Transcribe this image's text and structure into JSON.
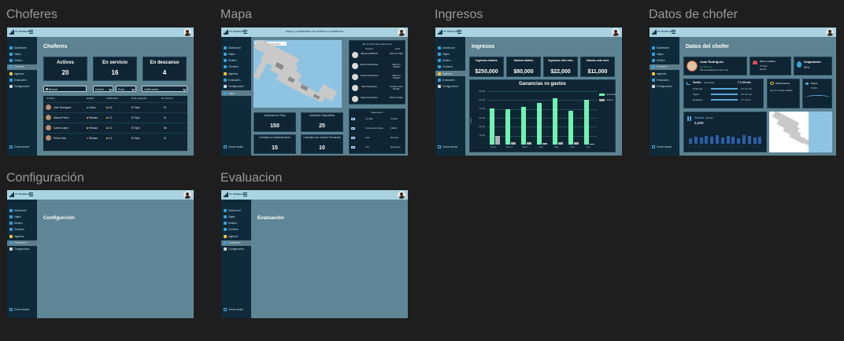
{
  "frames": {
    "choferes_title": "Choferes",
    "mapa_title": "Mapa",
    "ingresos_title": "Ingresos",
    "datos_title": "Datos de chofer",
    "config_title": "Configuración",
    "evaluacion_title": "Evaluacion"
  },
  "brand": "ZT TRABAJO",
  "sidebar": {
    "items": [
      "Dashboard",
      "Viajes",
      "Destino",
      "Choferes",
      "Ingresos",
      "Evaluación",
      "Configuración"
    ],
    "logout": "Cerrar sesión",
    "icon_colors": [
      "#3aa0d8",
      "#3aa0d8",
      "#3aa0d8",
      "#3aa0d8",
      "#f3c23a",
      "#3aa0d8",
      "#cfd8dc"
    ]
  },
  "choferes": {
    "title": "Choferes",
    "cards": [
      {
        "label": "Activos",
        "value": "20"
      },
      {
        "label": "En servicio",
        "value": "16"
      },
      {
        "label": "En descanso",
        "value": "4"
      }
    ],
    "search_placeholder": "Buscar",
    "filters": [
      "Estado",
      "Ruta",
      "Calificación"
    ],
    "columns": [
      "Nombre",
      "Estado",
      "Calificación",
      "Ruta asignada",
      "En servicio"
    ],
    "rows": [
      {
        "name": "Juan Rodríguez",
        "status": "Activo",
        "status_color": "#3ec87a",
        "rating": "4.6",
        "route": "El Tajín",
        "service": "Sí"
      },
      {
        "name": "Manuel Pérez",
        "status": "Retraso",
        "status_color": "#f3c23a",
        "rating": "4.2",
        "route": "El Tajín",
        "service": "Sí"
      },
      {
        "name": "Carlos López",
        "status": "Retraso",
        "status_color": "#f3c23a",
        "rating": "4.0",
        "route": "El Tajín",
        "service": "No"
      },
      {
        "name": "Pedro Díaz",
        "status": "Retraso",
        "status_color": "#e05050",
        "rating": "4.1",
        "route": "El Tajín",
        "service": "Sí"
      }
    ]
  },
  "mapa": {
    "header": "Mapa y Localización de choferes y estaciones",
    "search_placeholder": "Buscar estación de Metro",
    "driver_list_title": "Top en línea que quieres ver",
    "driver_cols": [
      "Nombre",
      "Ruta"
    ],
    "drivers": [
      {
        "name": "Miguel CORROS",
        "route": "Metro el Tajín"
      },
      {
        "name": "Ramiro Rodríguez",
        "route": "Metro el Pueblo"
      },
      {
        "name": "Jhosue Rodríguez",
        "route": "Metro el Pueblo"
      },
      {
        "name": "Juan Rodríguez",
        "route": "Centro Loma Bonita"
      },
      {
        "name": "Diego Hernández",
        "route": "Metro el Tajín"
      }
    ],
    "stats": [
      {
        "label": "Autobuses en Ruta",
        "value": "150"
      },
      {
        "label": "Autobuses Disponibles",
        "value": "25"
      },
      {
        "label": "Unidades en Mantenimiento",
        "value": "15"
      },
      {
        "label": "Unidades con Gestión Terminada",
        "value": "10"
      }
    ],
    "stations_title": "Estaciones",
    "stations": [
      {
        "name": "La Sala",
        "place": "Puebla"
      },
      {
        "name": "Terminal del Norte",
        "place": "CDMX"
      },
      {
        "name": "Gral.",
        "place": "Morelos"
      },
      {
        "name": "TGI",
        "place": "Querétaro"
      }
    ]
  },
  "ingresos": {
    "title": "Ingresos",
    "kpis": [
      {
        "label": "Ingresos totales",
        "value": "$250,000"
      },
      {
        "label": "Gastos totales",
        "value": "$80,000"
      },
      {
        "label": "Ingresos este mes",
        "value": "$22,000"
      },
      {
        "label": "Gastos este mes",
        "value": "$11,000"
      }
    ]
  },
  "chart_data": {
    "type": "bar",
    "title": "Ganancias vs gastos",
    "ylabel": "Pesos",
    "categories": [
      "Enero",
      "Febrero",
      "Marzo",
      "Abril",
      "Mayo",
      "Junio",
      "Julio"
    ],
    "ylim": [
      0,
      60000
    ],
    "yticks": [
      "60,000",
      "50,000",
      "40,000",
      "30,000",
      "20,000",
      "10,000"
    ],
    "series": [
      {
        "name": "Ganancias",
        "color": "#6ff3b0",
        "values": [
          41000,
          40000,
          42000,
          47000,
          52000,
          38000,
          50000
        ]
      },
      {
        "name": "Gastos",
        "color": "#b0b0b0",
        "values": [
          10000,
          3000,
          3000,
          2000,
          3000,
          3000,
          1000
        ]
      }
    ]
  },
  "datos": {
    "title": "Datos del chofer",
    "driver_name": "Juan Rodríguez",
    "driver_status": "En servicio",
    "driver_sub": "Última actualización: hace 2 min",
    "heart_label": "Ritmo cardiaco",
    "heart_value": "72 bpm",
    "heart_note": "Normal",
    "oxy_label": "Oxigenación",
    "oxy_value": "98%",
    "sleep_label": "Sueño",
    "sleep_note": "(de anoche)",
    "sleep_total": "7 h 30 min",
    "sleep_rows": [
      {
        "label": "Profundo",
        "value": "2 h 15 min"
      },
      {
        "label": "Ligero",
        "value": "4 h 10 min"
      },
      {
        "label": "Despierto",
        "value": "1 h 5 min"
      }
    ],
    "distract_label": "Distracciones",
    "distract_note": "Hoy con niveles estables",
    "steps_label": "Pasos",
    "steps_value": "5,200",
    "sleep_hist_label": "Sueño",
    "sleep_hist_note": "(horas)",
    "sleep_hist_value": "5,200",
    "days": [
      "L",
      "M",
      "M",
      "J",
      "V",
      "S",
      "D",
      "L",
      "M",
      "M",
      "J",
      "V",
      "S",
      "D"
    ]
  },
  "config": {
    "title": "Configurción"
  },
  "evaluacion": {
    "title": "Evaluación"
  }
}
